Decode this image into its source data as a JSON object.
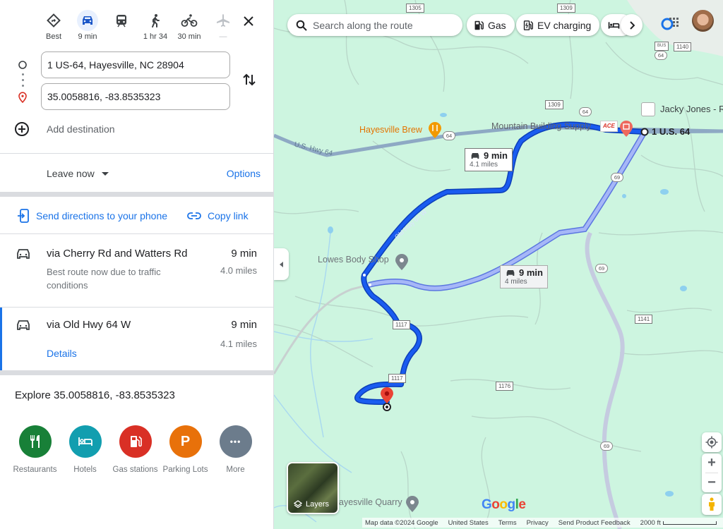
{
  "travel_modes": [
    {
      "id": "best",
      "icon": "best-route-icon",
      "label": "Best",
      "active": false
    },
    {
      "id": "driving",
      "icon": "car-icon",
      "label": "9 min",
      "active": true
    },
    {
      "id": "transit",
      "icon": "train-icon",
      "label": "",
      "active": false
    },
    {
      "id": "walking",
      "icon": "walk-icon",
      "label": "1 hr 34",
      "active": false
    },
    {
      "id": "cycling",
      "icon": "bike-icon",
      "label": "30 min",
      "active": false
    },
    {
      "id": "flight",
      "icon": "plane-icon",
      "label": "—",
      "active": false,
      "disabled": true
    }
  ],
  "directions": {
    "origin": "1 US-64, Hayesville, NC 28904",
    "destination": "35.0058816, -83.8535323",
    "add_destination": "Add destination"
  },
  "timing": {
    "leave_label": "Leave now",
    "options_label": "Options"
  },
  "share": {
    "send_label": "Send directions to your phone",
    "copy_label": "Copy link"
  },
  "routes": [
    {
      "name": "via Cherry Rd and Watters Rd",
      "time": "9 min",
      "distance": "4.0 miles",
      "note": "Best route now due to traffic conditions",
      "selected": false
    },
    {
      "name": "via Old Hwy 64 W",
      "time": "9 min",
      "distance": "4.1 miles",
      "details_label": "Details",
      "selected": true
    }
  ],
  "explore": {
    "title": "Explore 35.0058816, -83.8535323",
    "categories": [
      {
        "label": "Restaurants",
        "icon": "restaurant-icon",
        "color": "#188038"
      },
      {
        "label": "Hotels",
        "icon": "hotel-icon",
        "color": "#129eaf"
      },
      {
        "label": "Gas stations",
        "icon": "gas-station-icon",
        "color": "#d93025"
      },
      {
        "label": "Parking Lots",
        "icon": "parking-icon",
        "glyph": "P",
        "color": "#e8710a"
      },
      {
        "label": "More",
        "icon": "more-icon",
        "glyph": "•••",
        "color": "#6c7c8c"
      }
    ]
  },
  "map": {
    "search_placeholder": "Search along the route",
    "chips": [
      {
        "label": "Gas",
        "icon": "gas-station-icon"
      },
      {
        "label": "EV charging",
        "icon": "ev-charging-icon"
      },
      {
        "label": "",
        "icon": "hotel-icon"
      }
    ],
    "places": [
      {
        "name": "Hayesville Brew",
        "color": "#e37400"
      },
      {
        "name": "Mountain Building Supply",
        "color": "#5f6368"
      },
      {
        "name": "Jacky Jones - R",
        "color": "#3c4043"
      },
      {
        "name": "1 U.S. 64",
        "color": "#202124"
      },
      {
        "name": "Lowes Body Shop",
        "color": "#70757a"
      },
      {
        "name": "ayesville Quarry",
        "color": "#70757a"
      }
    ],
    "road_labels": {
      "us64": "U.S. Hwy 64",
      "old64": "Old Hwy 64 W"
    },
    "shields": {
      "s1305": "1305",
      "s1309a": "1309",
      "s1309b": "1309",
      "s1140a": "1140",
      "s1140b": "1140",
      "s1141": "1141",
      "s1176": "1176",
      "s1117a": "1117",
      "s1117b": "1117",
      "us64a": "64",
      "us64b": "64",
      "us64c": "64",
      "us64d": "64",
      "nc69a": "69",
      "nc69b": "69",
      "nc69c": "69",
      "bus": "BUS",
      "ace": "ACE"
    },
    "callouts": [
      {
        "time": "9 min",
        "distance": "4.1 miles"
      },
      {
        "time": "9 min",
        "distance": "4 miles"
      }
    ],
    "layers_label": "Layers",
    "google_logo": [
      "G",
      "o",
      "o",
      "g",
      "l",
      "e"
    ],
    "footer": {
      "map_data": "Map data ©2024 Google",
      "region": "United States",
      "terms": "Terms",
      "privacy": "Privacy",
      "feedback": "Send Product Feedback",
      "scale": "2000 ft"
    },
    "colors": {
      "route_primary": "#1a5cf0",
      "route_alt": "#a6b7f7",
      "land": "#cdf5e0"
    }
  }
}
